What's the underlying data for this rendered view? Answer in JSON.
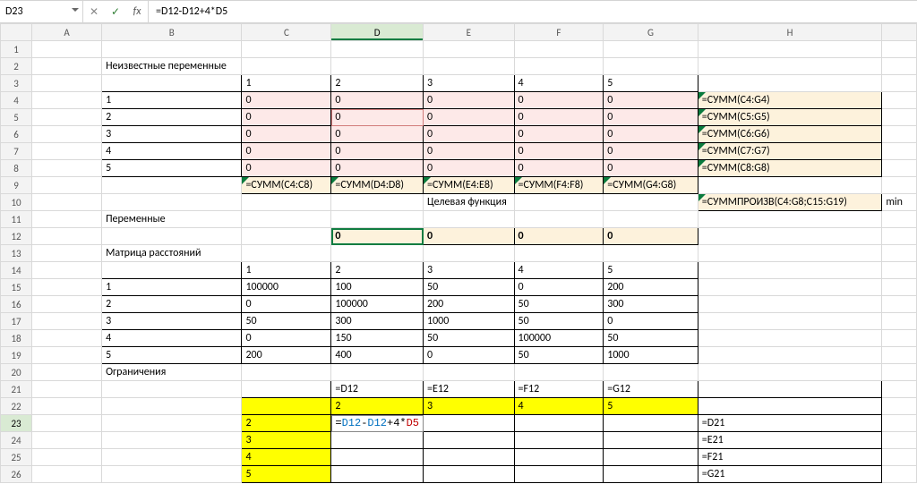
{
  "namebox": "D23",
  "fx_label": "fx",
  "formula_bar": "=D12-D12+4*D5",
  "columns": [
    "A",
    "B",
    "C",
    "D",
    "E",
    "F",
    "G",
    "H"
  ],
  "selected_col": "D",
  "selected_row": 23,
  "labels": {
    "unknown_vars": "Неизвестные переменные",
    "vars": "Переменные",
    "distance_matrix": "Матрица расстояний",
    "constraints": "Ограничения",
    "objective": "Целевая функция",
    "min": "min"
  },
  "hdr_cols": {
    "c": "1",
    "d": "2",
    "e": "3",
    "f": "4",
    "g": "5"
  },
  "rows_1to5": [
    "1",
    "2",
    "3",
    "4",
    "5"
  ],
  "zeros": "0",
  "sumrow": {
    "c": "=СУММ(C4:C8)",
    "d": "=СУММ(D4:D8)",
    "e": "=СУММ(E4:E8)",
    "f": "=СУММ(F4:F8)",
    "g": "=СУММ(G4:G8)"
  },
  "sumcol": {
    "r4": "=СУММ(C4:G4)",
    "r5": "=СУММ(C5:G5)",
    "r6": "=СУММ(C6:G6)",
    "r7": "=СУММ(C7:G7)",
    "r8": "=СУММ(C8:G8)"
  },
  "sumprod": "=СУММПРОИЗВ(C4:G8;C15:G19)",
  "vars_row12": {
    "d": "0",
    "e": "0",
    "f": "0",
    "g": "0"
  },
  "dist": {
    "r15": {
      "b": "1",
      "c": "100000",
      "d": "100",
      "e": "50",
      "f": "0",
      "g": "200"
    },
    "r16": {
      "b": "2",
      "c": "0",
      "d": "100000",
      "e": "200",
      "f": "50",
      "g": "300"
    },
    "r17": {
      "b": "3",
      "c": "50",
      "d": "300",
      "e": "1000",
      "f": "50",
      "g": "0"
    },
    "r18": {
      "b": "4",
      "c": "0",
      "d": "150",
      "e": "50",
      "f": "100000",
      "g": "50"
    },
    "r19": {
      "b": "5",
      "c": "200",
      "d": "400",
      "e": "0",
      "f": "50",
      "g": "1000"
    }
  },
  "row21": {
    "d": "=D12",
    "e": "=E12",
    "f": "=F12",
    "g": "=G12"
  },
  "row22": {
    "c": "",
    "d": "2",
    "e": "3",
    "f": "4",
    "g": "5"
  },
  "col_c_22_26": {
    "r23": "2",
    "r24": "3",
    "r25": "4",
    "r26": "5"
  },
  "h_21_26": {
    "r23": "=D21",
    "r24": "=E21",
    "r25": "=F21",
    "r26": "=G21"
  },
  "editing_tokens": {
    "a": "=",
    "b": "D12",
    "c": "-",
    "d": "D12",
    "e": "+4*",
    "f": "D5"
  },
  "cancel_glyph": "✕",
  "ok_glyph": "✓"
}
